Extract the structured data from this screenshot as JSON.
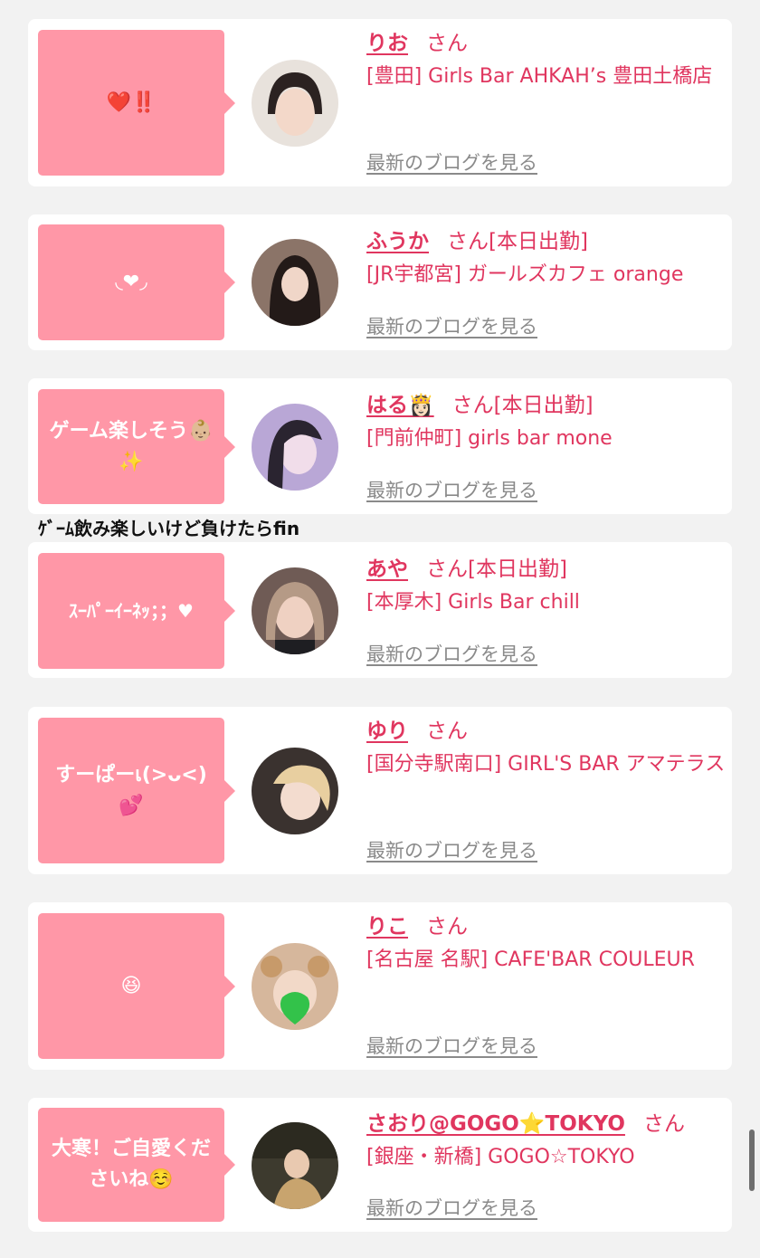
{
  "entries": [
    {
      "bubble": "❤️‼️",
      "name": "りお",
      "san": "さん",
      "status": "",
      "shop": "[豊田] Girls Bar AHKAH’s 豊田土橋店",
      "blog": "最新のブログを見る"
    },
    {
      "bubble": "◟❤︎◞",
      "name": "ふうか",
      "san": "さん",
      "status": "[本日出勤]",
      "shop": "[JR宇都宮] ガールズカフェ orange",
      "blog": "最新のブログを見る"
    },
    {
      "bubble": "ゲーム楽しそう👶🏼\n✨",
      "name": "はる👸🏻",
      "san": "さん",
      "status": "[本日出勤]",
      "shop": "[門前仲町] girls bar mone",
      "blog": "最新のブログを見る"
    },
    {
      "bubble": "ｽｰﾊﾟｰｲｰﾈｯ；；♥",
      "name": "あや",
      "san": "さん",
      "status": "[本日出勤]",
      "shop": "[本厚木] Girls Bar chill",
      "blog": "最新のブログを見る"
    },
    {
      "bubble": "すーぱーเ(>ᴗ<)\n💕",
      "name": "ゆり",
      "san": "さん",
      "status": "",
      "shop": "[国分寺駅南口] GIRL'S BAR アマテラス",
      "blog": "最新のブログを見る"
    },
    {
      "bubble": "😆",
      "name": "りこ",
      "san": "さん",
      "status": "",
      "shop": "[名古屋 名駅] CAFE'BAR COULEUR",
      "blog": "最新のブログを見る"
    },
    {
      "bubble": "大寒！ご自愛くださいね☺️",
      "name": "さおり@GOGO⭐️TOKYO",
      "san": "さん",
      "status": "",
      "shop": "[銀座・新橋] GOGO☆TOKYO",
      "blog": "最新のブログを見る"
    }
  ],
  "standalone_text": "ｹﾞｰﾑ飲み楽しいけど負けたらfin"
}
